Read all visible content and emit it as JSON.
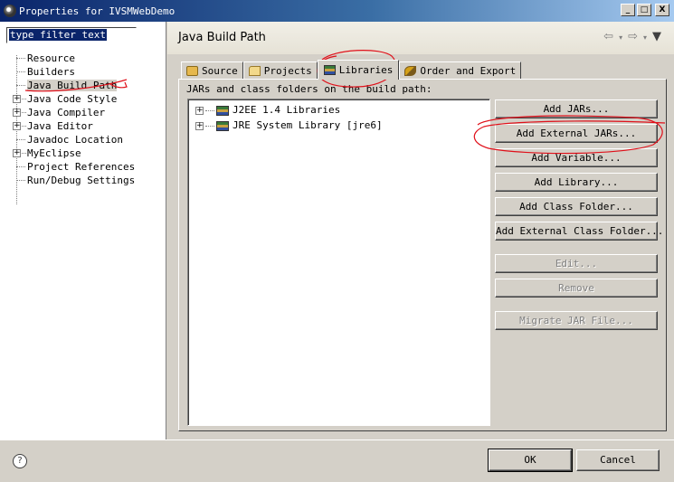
{
  "window": {
    "title": "Properties for IVSMWebDemo",
    "buttons": {
      "minimize": "_",
      "maximize": "□",
      "close": "X"
    }
  },
  "filter": {
    "value": "type filter text"
  },
  "sidebar": {
    "items": [
      {
        "label": "Resource",
        "expandable": false
      },
      {
        "label": "Builders",
        "expandable": false
      },
      {
        "label": "Java Build Path",
        "expandable": false,
        "selected": true
      },
      {
        "label": "Java Code Style",
        "expandable": true
      },
      {
        "label": "Java Compiler",
        "expandable": true
      },
      {
        "label": "Java Editor",
        "expandable": true
      },
      {
        "label": "Javadoc Location",
        "expandable": false
      },
      {
        "label": "MyEclipse",
        "expandable": true
      },
      {
        "label": "Project References",
        "expandable": false
      },
      {
        "label": "Run/Debug Settings",
        "expandable": false
      }
    ]
  },
  "page": {
    "title": "Java Build Path",
    "nav": {
      "back": "⇦",
      "forward": "⇨",
      "dropdown": "▾",
      "menu": "▼"
    }
  },
  "tabs": [
    {
      "label": "Source",
      "icon": "source-folder-icon"
    },
    {
      "label": "Projects",
      "icon": "projects-folder-icon"
    },
    {
      "label": "Libraries",
      "icon": "libraries-icon",
      "active": true
    },
    {
      "label": "Order and Export",
      "icon": "order-export-icon"
    }
  ],
  "libraries": {
    "label": "JARs and class folders on the build path:",
    "items": [
      {
        "label": "J2EE 1.4 Libraries"
      },
      {
        "label": "JRE System Library [jre6]"
      }
    ]
  },
  "buttons": {
    "add_jars": "Add JARs...",
    "add_external_jars": "Add External JARs...",
    "add_variable": "Add Variable...",
    "add_library": "Add Library...",
    "add_class_folder": "Add Class Folder...",
    "add_external_class_folder": "Add External Class Folder...",
    "edit": "Edit...",
    "remove": "Remove",
    "migrate": "Migrate JAR File..."
  },
  "footer": {
    "help": "?",
    "ok": "OK",
    "cancel": "Cancel"
  },
  "colors": {
    "title_bar": "#0a246a",
    "face": "#d4d0c8",
    "annotation": "#e0101a"
  }
}
